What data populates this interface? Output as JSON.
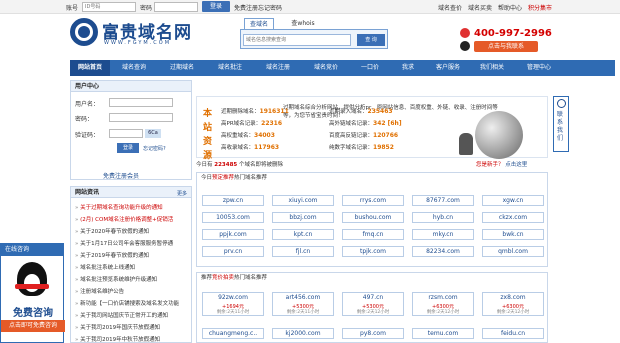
{
  "topbar": {
    "account_label": "账号",
    "account_placeholder": "ID号码",
    "password_label": "密码",
    "login_btn": "登录",
    "register_link": "免费注册",
    "forgot_link": "忘记密码",
    "right_links": [
      "域名查价",
      "域名买卖",
      "帮助中心",
      "积分集市"
    ]
  },
  "logo": {
    "name": "富贵域名网",
    "sub": "WWW.FGYM.COM"
  },
  "search": {
    "tab_active": "查域名",
    "tab_other": "查whois",
    "placeholder": "域名信息搜索查询",
    "button": "查 询"
  },
  "contact": {
    "phone": "400-997-2996",
    "qq_button": "点击与我联系"
  },
  "nav": [
    "网站首页",
    "域名查询",
    "过期域名",
    "域名批注",
    "域名注册",
    "域名竞价",
    "一口价",
    "我求",
    "客户服务",
    "我们相关",
    "管理中心"
  ],
  "login": {
    "title": "用户中心",
    "user_label": "用户名：",
    "pass_label": "密码：",
    "code_label": "验证码：",
    "code_value": "6Ca",
    "login_btn": "登录",
    "forgot": "忘记密码?",
    "register": "免费注册会员"
  },
  "news": {
    "title": "网站资讯",
    "more": "更多",
    "items": [
      {
        "text": "关于过期域名查询功能升级的通知",
        "hot": true
      },
      {
        "text": "(2月) COM域名注册价格调整+促销活",
        "hot": true
      },
      {
        "text": "关于2020年春节放假的通知",
        "hot": false
      },
      {
        "text": "关于1月17日公司年会客服服务暂停通",
        "hot": false
      },
      {
        "text": "关于2019年春节放假的通知",
        "hot": false
      },
      {
        "text": "域名批注系统上线通知",
        "hot": false
      },
      {
        "text": "域名批注预览系统维护升级通知",
        "hot": false
      },
      {
        "text": "注册域名维护公告",
        "hot": false
      },
      {
        "text": "新功能【一口价店铺搜索及域名发文功能",
        "hot": false
      },
      {
        "text": "关于我司网站国庆节正常开工的通知",
        "hot": false
      },
      {
        "text": "关于我司2019年国庆节放假通知",
        "hot": false
      },
      {
        "text": "关于我司2019年中秋节放假通知",
        "hot": false
      }
    ]
  },
  "float_ad": {
    "title": "在线咨询",
    "big": "免费咨询",
    "sub": "点击即可免费咨询"
  },
  "stats": {
    "side_label": "本站资源",
    "rows": [
      {
        "label": "近期删除域名：",
        "value": "1916311",
        "label2": "近期录入域名：",
        "value2": "235463"
      },
      {
        "label": "高PR域名记录：",
        "value": "22316",
        "label2": "高外链域名记录：",
        "value2": "342 [6h]"
      },
      {
        "label": "高权重域名：",
        "value": "34003",
        "label2": "百度高反链记录：",
        "value2": "120766"
      },
      {
        "label": "高收录域名：",
        "value": "117963",
        "label2": "纯数字域名记录：",
        "value2": "19852"
      }
    ],
    "desc": "过期域名综合分析网站，提供分析pr、原网站信息、百度权重、外链、收录、注册时间等等，为您节省宝贵时间！"
  },
  "side_contact": "联系我们",
  "count": {
    "prefix": "今日有",
    "value": "223485",
    "suffix": "个域名即将被删除"
  },
  "newbie": {
    "q": "您是新手？",
    "link": "点击这里"
  },
  "hot_section": {
    "prefix": "今日",
    "highlight": "预定推荐",
    "suffix": "热门域名推荐",
    "domains": [
      "zpw.cn",
      "xiuyi.com",
      "rrys.com",
      "87677.com",
      "xgw.cn",
      "10053.com",
      "bbzj.com",
      "bushou.com",
      "hyb.cn",
      "ckzx.com",
      "ppjk.com",
      "kpt.cn",
      "fmq.cn",
      "mky.cn",
      "bwk.cn",
      "prv.cn",
      "fjl.cn",
      "tpjk.com",
      "82234.com",
      "qmbl.com"
    ]
  },
  "auction_section": {
    "prefix": "推荐",
    "highlight": "竞价拍卖",
    "suffix": "热门域名推荐",
    "items": [
      {
        "domain": "92zw.com",
        "price": "+1694元",
        "time": "剩余:2天11小时"
      },
      {
        "domain": "art456.com",
        "price": "+5300元",
        "time": "剩余:2天11小时"
      },
      {
        "domain": "497.cn",
        "price": "+5300元",
        "time": "剩余:2天12小时"
      },
      {
        "domain": "rzsm.com",
        "price": "+6300元",
        "time": "剩余:2天12小时"
      },
      {
        "domain": "zx8.com",
        "price": "+6300元",
        "time": "剩余:2天12小时"
      }
    ],
    "row2": [
      "chuangmeng.c..",
      "kj2000.com",
      "py8.com",
      "temu.com",
      "feidu.cn"
    ]
  }
}
